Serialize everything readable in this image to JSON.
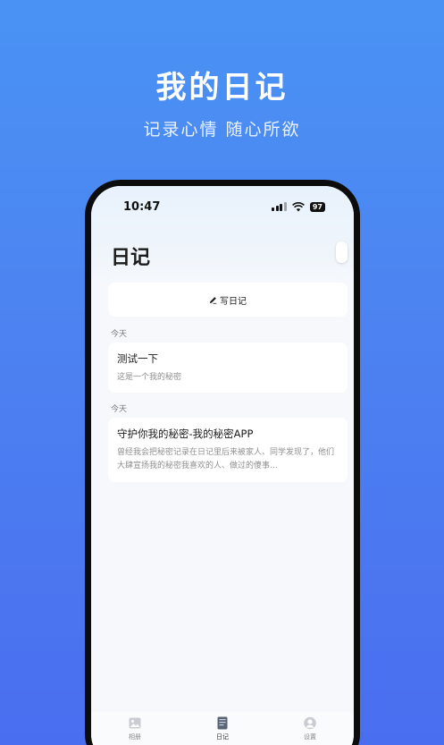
{
  "hero": {
    "title": "我的日记",
    "subtitle": "记录心情 随心所欲"
  },
  "status_bar": {
    "time": "10:47",
    "battery": "97"
  },
  "page": {
    "title": "日记"
  },
  "write_button": {
    "label": "写日记"
  },
  "entries": [
    {
      "date_label": "今天",
      "title": "测试一下",
      "body": "这是一个我的秘密"
    },
    {
      "date_label": "今天",
      "title": "守护你我的秘密-我的秘密APP",
      "body": "曾经我会把秘密记录在日记里后来被家人、同学发现了，他们大肆宣扬我的秘密我喜欢的人、做过的傻事..."
    }
  ],
  "tabs": [
    {
      "label": "相册",
      "icon": "photo-icon",
      "active": false
    },
    {
      "label": "日记",
      "icon": "diary-icon",
      "active": true
    },
    {
      "label": "设置",
      "icon": "profile-icon",
      "active": false
    }
  ],
  "colors": {
    "background_top": "#4a93f4",
    "background_bottom": "#4a6ef0",
    "screen": "#f6f8fc",
    "card": "#ffffff"
  }
}
